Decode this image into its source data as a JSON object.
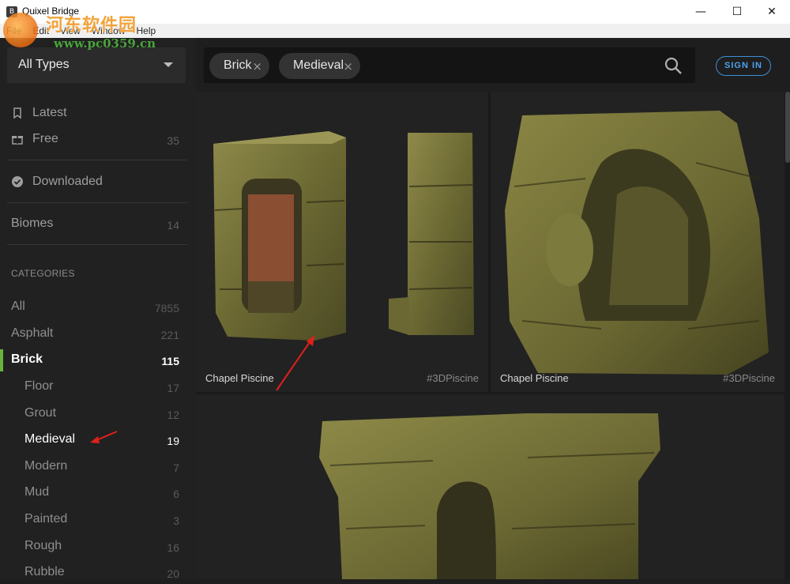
{
  "window": {
    "title": "Quixel Bridge",
    "controls": {
      "minimize": "—",
      "maximize": "☐",
      "close": "✕"
    }
  },
  "menu": [
    "File",
    "Edit",
    "View",
    "Window",
    "Help"
  ],
  "watermark": {
    "text": "河东软件园",
    "url": "www.pc0359.cn"
  },
  "sidebar": {
    "type_select": "All Types",
    "nav": [
      {
        "label": "Latest",
        "icon": "bookmark-icon",
        "count": ""
      },
      {
        "label": "Free",
        "icon": "gift-icon",
        "count": "35"
      },
      {
        "label": "Downloaded",
        "icon": "check-circle-icon",
        "count": ""
      },
      {
        "label": "Biomes",
        "icon": "",
        "count": "14"
      }
    ],
    "categories_heading": "CATEGORIES",
    "categories": [
      {
        "label": "All",
        "count": "7855"
      },
      {
        "label": "Asphalt",
        "count": "221"
      },
      {
        "label": "Brick",
        "count": "115",
        "state": "active"
      },
      {
        "label": "Floor",
        "count": "17",
        "sub": true
      },
      {
        "label": "Grout",
        "count": "12",
        "sub": true
      },
      {
        "label": "Medieval",
        "count": "19",
        "sub": true,
        "state": "selected"
      },
      {
        "label": "Modern",
        "count": "7",
        "sub": true
      },
      {
        "label": "Mud",
        "count": "6",
        "sub": true
      },
      {
        "label": "Painted",
        "count": "3",
        "sub": true
      },
      {
        "label": "Rough",
        "count": "16",
        "sub": true
      },
      {
        "label": "Rubble",
        "count": "20",
        "sub": true
      }
    ]
  },
  "search": {
    "chips": [
      "Brick",
      "Medieval"
    ],
    "chip_close": "×"
  },
  "header": {
    "sign_in": "SIGN IN"
  },
  "results": [
    {
      "name": "Chapel Piscine",
      "tag": "#3DPiscine"
    },
    {
      "name": "Chapel Piscine",
      "tag": "#3DPiscine"
    },
    {
      "name": "",
      "tag": ""
    }
  ],
  "colors": {
    "accent_green": "#68b33d",
    "sign_in_blue": "#4aa3f0",
    "stone_moss": "#7d7a3e",
    "annotation_red": "#e0201b"
  }
}
